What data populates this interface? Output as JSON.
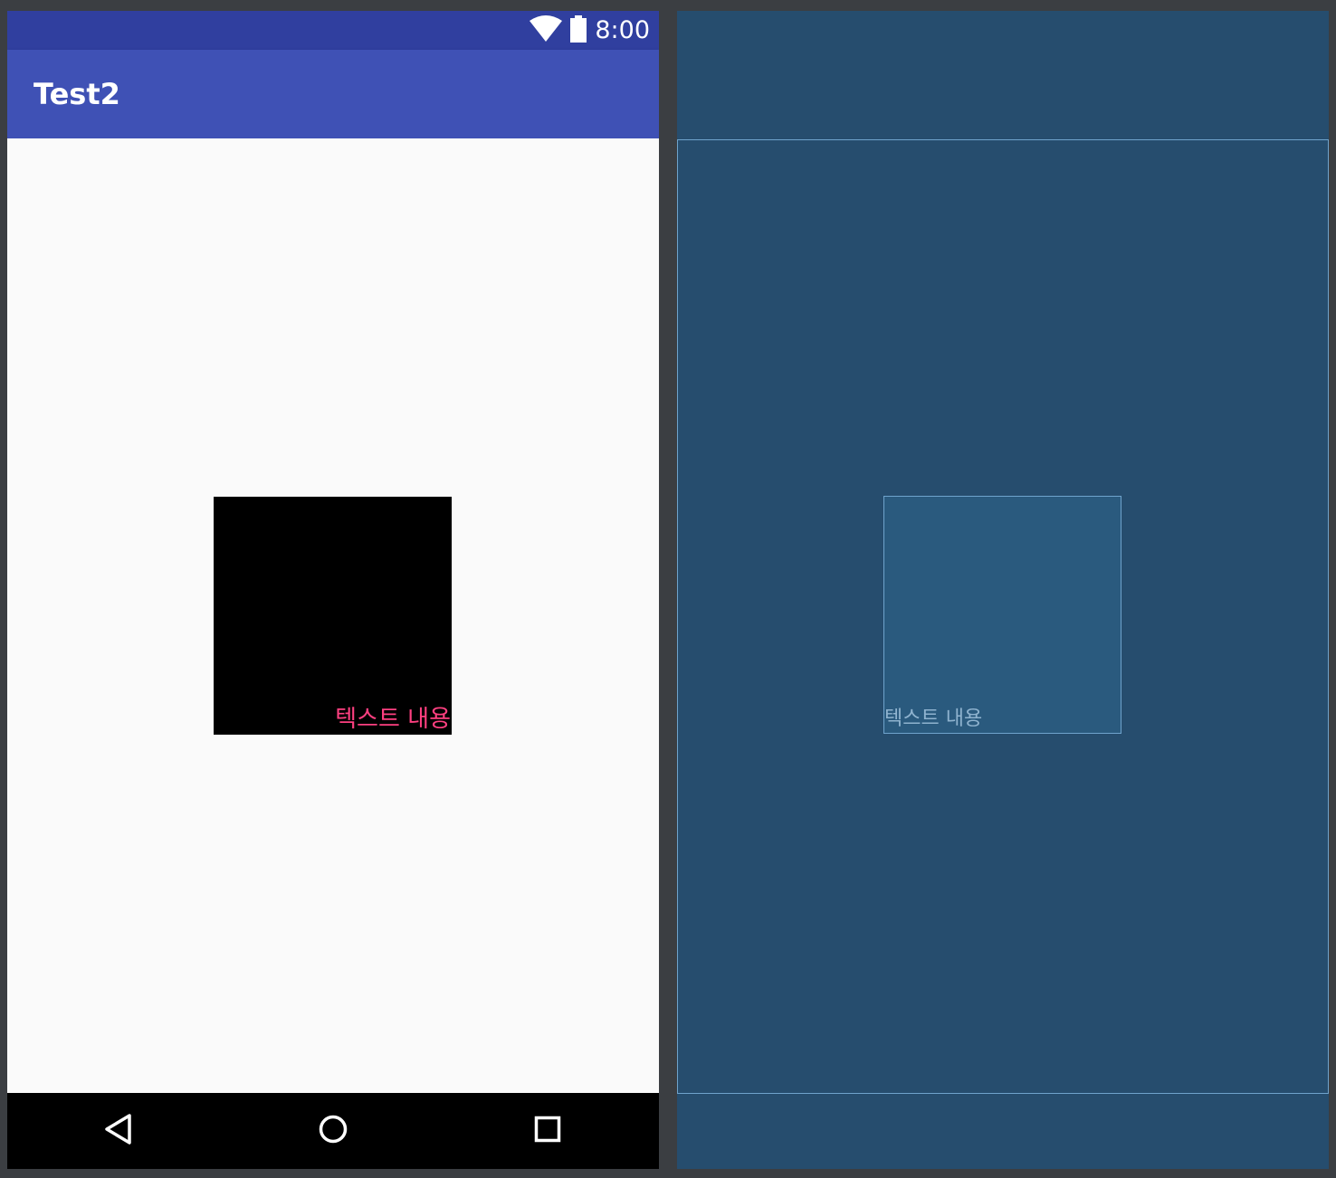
{
  "design_view": {
    "status_bar": {
      "time": "8:00",
      "wifi_icon": "wifi-icon",
      "battery_icon": "battery-icon",
      "color": "#303f9f"
    },
    "app_bar": {
      "title": "Test2",
      "color": "#3f51b5"
    },
    "content": {
      "box_text": "텍스트 내용",
      "box_color": "#000000",
      "text_color": "#ff4081"
    },
    "nav_bar": {
      "back_icon": "back-triangle-icon",
      "home_icon": "home-circle-icon",
      "recents_icon": "recents-square-icon"
    }
  },
  "blueprint_view": {
    "box_text": "텍스트 내용",
    "background": "#264d6e",
    "outline_color": "#6fa3cc"
  }
}
